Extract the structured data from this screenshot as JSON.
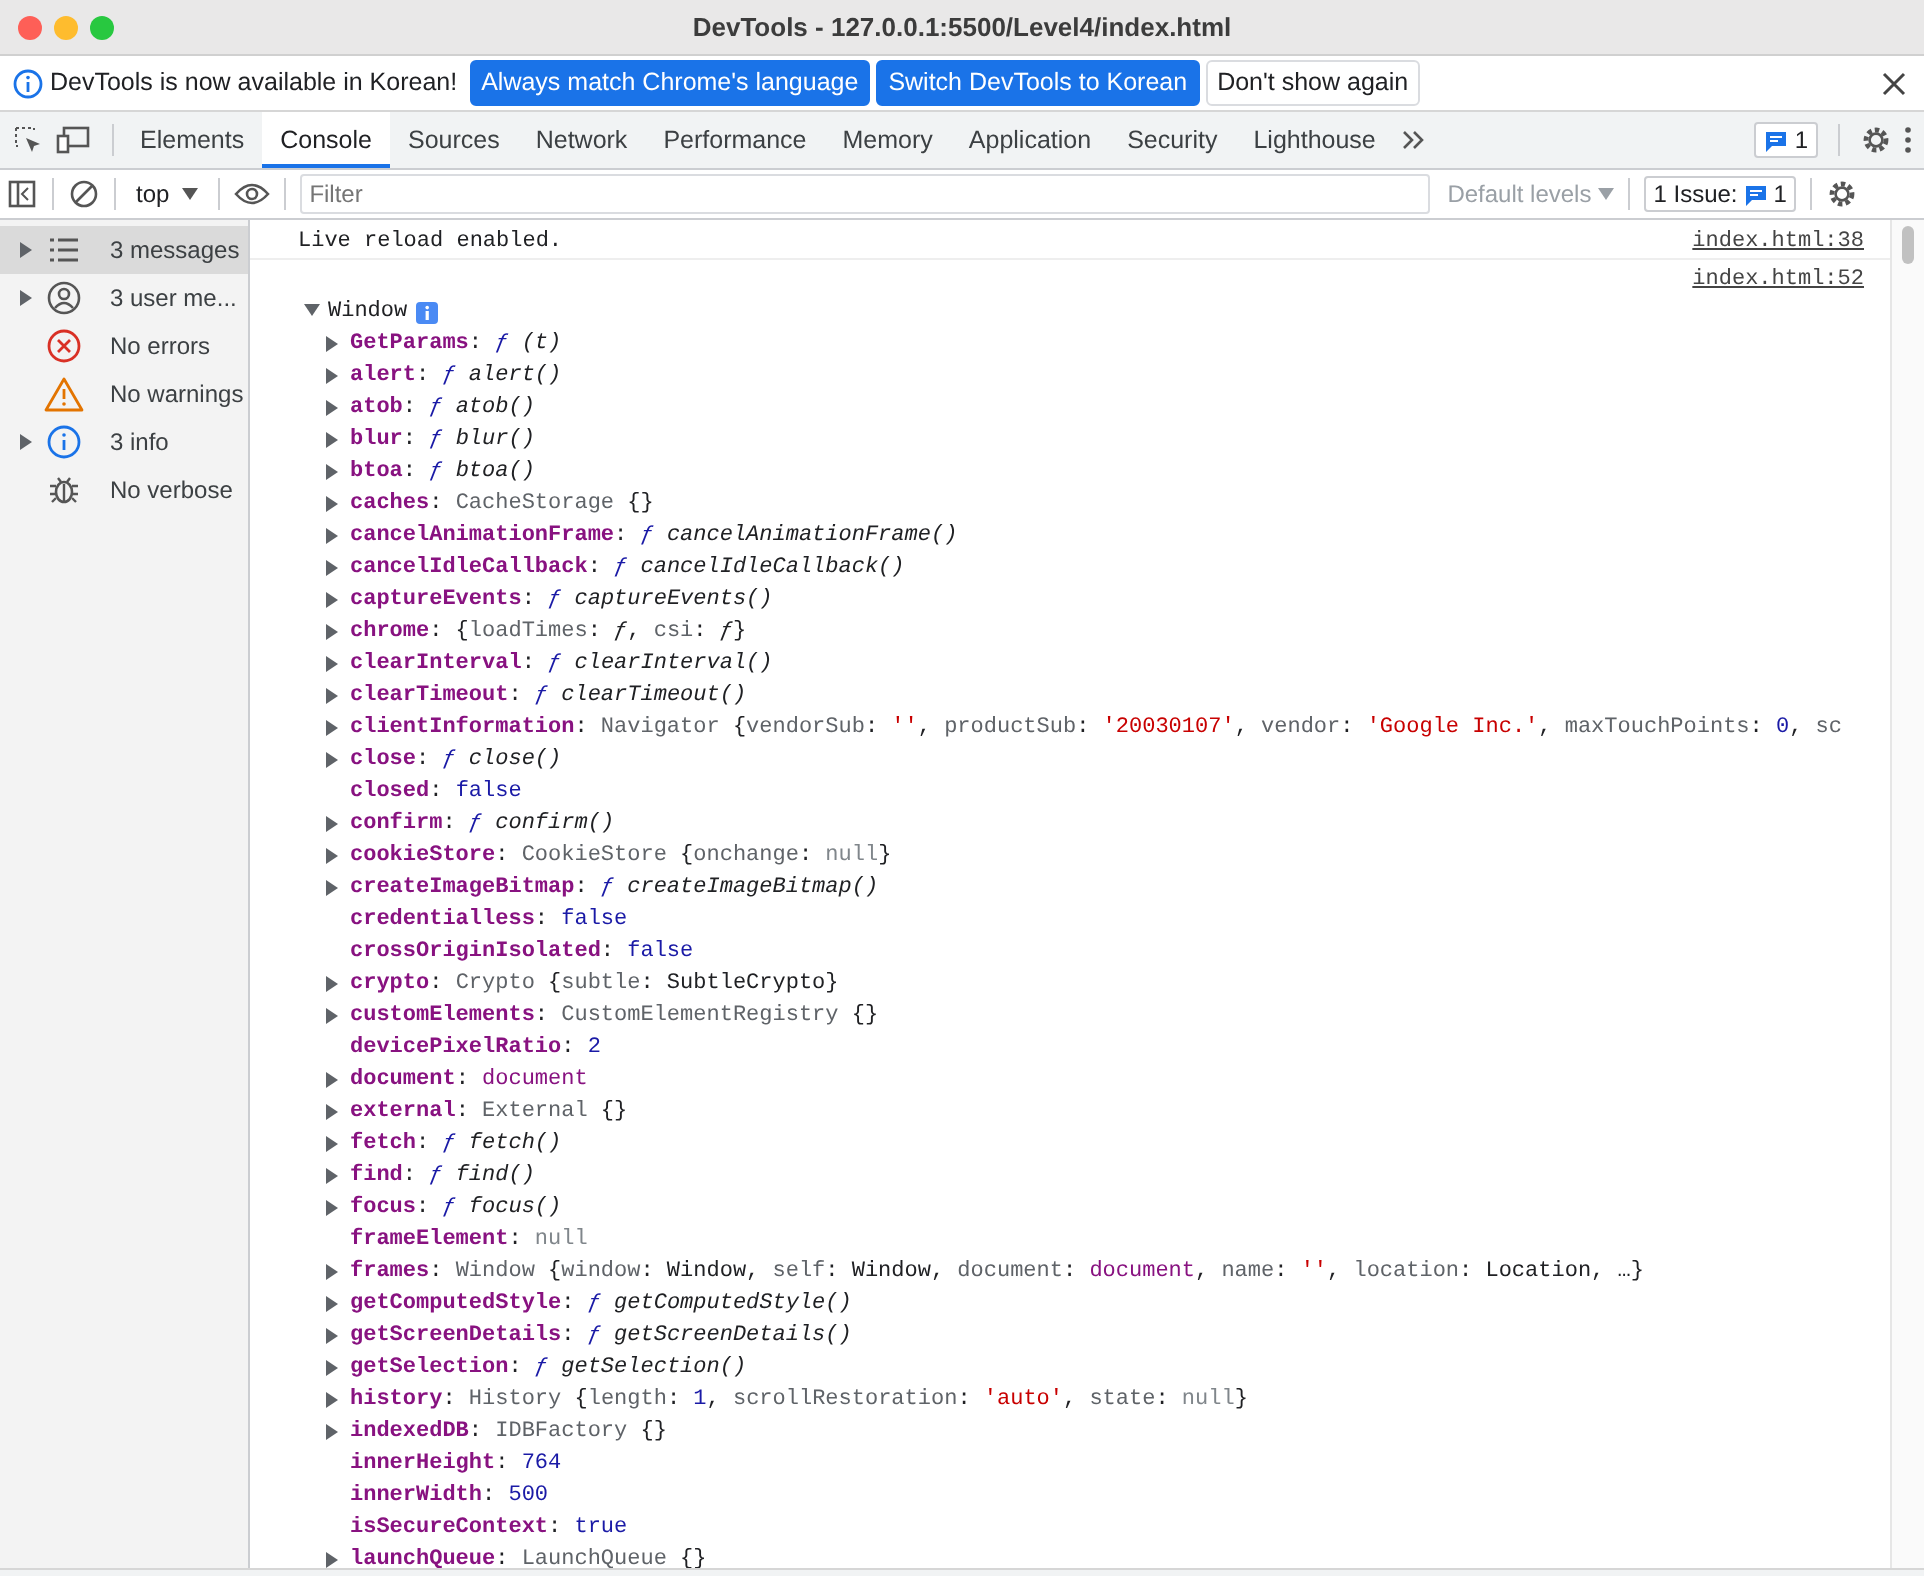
{
  "window": {
    "title": "DevTools - 127.0.0.1:5500/Level4/index.html"
  },
  "infobar": {
    "message": "DevTools is now available in Korean!",
    "buttons": [
      {
        "label": "Always match Chrome's language",
        "kind": "primary"
      },
      {
        "label": "Switch DevTools to Korean",
        "kind": "primary"
      },
      {
        "label": "Don't show again",
        "kind": "secondary"
      }
    ]
  },
  "tabs": [
    {
      "label": "Elements",
      "selected": false
    },
    {
      "label": "Console",
      "selected": true
    },
    {
      "label": "Sources",
      "selected": false
    },
    {
      "label": "Network",
      "selected": false
    },
    {
      "label": "Performance",
      "selected": false
    },
    {
      "label": "Memory",
      "selected": false
    },
    {
      "label": "Application",
      "selected": false
    },
    {
      "label": "Security",
      "selected": false
    },
    {
      "label": "Lighthouse",
      "selected": false
    }
  ],
  "message_badge": "1",
  "toolbar": {
    "context": "top",
    "filter_placeholder": "Filter",
    "levels": "Default levels",
    "issues_label": "1 Issue:",
    "issues_count": "1"
  },
  "sidebar": {
    "items": [
      {
        "kind": "messages",
        "label": "3 messages",
        "expandable": true,
        "selected": true
      },
      {
        "kind": "user",
        "label": "3 user me...",
        "expandable": true,
        "selected": false
      },
      {
        "kind": "errors",
        "label": "No errors",
        "expandable": false,
        "selected": false
      },
      {
        "kind": "warnings",
        "label": "No warnings",
        "expandable": false,
        "selected": false
      },
      {
        "kind": "info",
        "label": "3 info",
        "expandable": true,
        "selected": false
      },
      {
        "kind": "verbose",
        "label": "No verbose",
        "expandable": false,
        "selected": false
      }
    ]
  },
  "console": {
    "messages": [
      {
        "text": "Live reload enabled.",
        "source": "index.html:38"
      },
      {
        "source": "index.html:52",
        "object": {
          "label": "Window",
          "expanded": true,
          "properties": [
            {
              "key": "GetParams",
              "expandable": true,
              "value": [
                {
                  "kind": "punct",
                  "text": ": "
                },
                {
                  "kind": "fn",
                  "text": "ƒ"
                },
                {
                  "kind": "call",
                  "text": " (t)"
                }
              ]
            },
            {
              "key": "alert",
              "expandable": true,
              "value": [
                {
                  "kind": "punct",
                  "text": ": "
                },
                {
                  "kind": "fn",
                  "text": "ƒ"
                },
                {
                  "kind": "call",
                  "text": " alert()"
                }
              ]
            },
            {
              "key": "atob",
              "expandable": true,
              "value": [
                {
                  "kind": "punct",
                  "text": ": "
                },
                {
                  "kind": "fn",
                  "text": "ƒ"
                },
                {
                  "kind": "call",
                  "text": " atob()"
                }
              ]
            },
            {
              "key": "blur",
              "expandable": true,
              "value": [
                {
                  "kind": "punct",
                  "text": ": "
                },
                {
                  "kind": "fn",
                  "text": "ƒ"
                },
                {
                  "kind": "call",
                  "text": " blur()"
                }
              ]
            },
            {
              "key": "btoa",
              "expandable": true,
              "value": [
                {
                  "kind": "punct",
                  "text": ": "
                },
                {
                  "kind": "fn",
                  "text": "ƒ"
                },
                {
                  "kind": "call",
                  "text": " btoa()"
                }
              ]
            },
            {
              "key": "caches",
              "expandable": true,
              "value": [
                {
                  "kind": "punct",
                  "text": ": "
                },
                {
                  "kind": "type",
                  "text": "CacheStorage"
                },
                {
                  "kind": "punct",
                  "text": " {}"
                }
              ]
            },
            {
              "key": "cancelAnimationFrame",
              "expandable": true,
              "value": [
                {
                  "kind": "punct",
                  "text": ": "
                },
                {
                  "kind": "fn",
                  "text": "ƒ"
                },
                {
                  "kind": "call",
                  "text": " cancelAnimationFrame()"
                }
              ]
            },
            {
              "key": "cancelIdleCallback",
              "expandable": true,
              "value": [
                {
                  "kind": "punct",
                  "text": ": "
                },
                {
                  "kind": "fn",
                  "text": "ƒ"
                },
                {
                  "kind": "call",
                  "text": " cancelIdleCallback()"
                }
              ]
            },
            {
              "key": "captureEvents",
              "expandable": true,
              "value": [
                {
                  "kind": "punct",
                  "text": ": "
                },
                {
                  "kind": "fn",
                  "text": "ƒ"
                },
                {
                  "kind": "call",
                  "text": " captureEvents()"
                }
              ]
            },
            {
              "key": "chrome",
              "expandable": true,
              "value": [
                {
                  "kind": "punct",
                  "text": ": {"
                },
                {
                  "kind": "prop",
                  "text": "loadTimes"
                },
                {
                  "kind": "punct",
                  "text": ": "
                },
                {
                  "kind": "call",
                  "text": "ƒ"
                },
                {
                  "kind": "punct",
                  "text": ", "
                },
                {
                  "kind": "prop",
                  "text": "csi"
                },
                {
                  "kind": "punct",
                  "text": ": "
                },
                {
                  "kind": "call",
                  "text": "ƒ"
                },
                {
                  "kind": "punct",
                  "text": "}"
                }
              ]
            },
            {
              "key": "clearInterval",
              "expandable": true,
              "value": [
                {
                  "kind": "punct",
                  "text": ": "
                },
                {
                  "kind": "fn",
                  "text": "ƒ"
                },
                {
                  "kind": "call",
                  "text": " clearInterval()"
                }
              ]
            },
            {
              "key": "clearTimeout",
              "expandable": true,
              "value": [
                {
                  "kind": "punct",
                  "text": ": "
                },
                {
                  "kind": "fn",
                  "text": "ƒ"
                },
                {
                  "kind": "call",
                  "text": " clearTimeout()"
                }
              ]
            },
            {
              "key": "clientInformation",
              "expandable": true,
              "value": [
                {
                  "kind": "punct",
                  "text": ": "
                },
                {
                  "kind": "type",
                  "text": "Navigator"
                },
                {
                  "kind": "punct",
                  "text": " {"
                },
                {
                  "kind": "prop",
                  "text": "vendorSub"
                },
                {
                  "kind": "punct",
                  "text": ": "
                },
                {
                  "kind": "str",
                  "text": "''"
                },
                {
                  "kind": "punct",
                  "text": ", "
                },
                {
                  "kind": "prop",
                  "text": "productSub"
                },
                {
                  "kind": "punct",
                  "text": ": "
                },
                {
                  "kind": "str",
                  "text": "'20030107'"
                },
                {
                  "kind": "punct",
                  "text": ", "
                },
                {
                  "kind": "prop",
                  "text": "vendor"
                },
                {
                  "kind": "punct",
                  "text": ": "
                },
                {
                  "kind": "str",
                  "text": "'Google Inc.'"
                },
                {
                  "kind": "punct",
                  "text": ", "
                },
                {
                  "kind": "prop",
                  "text": "maxTouchPoints"
                },
                {
                  "kind": "punct",
                  "text": ": "
                },
                {
                  "kind": "num",
                  "text": "0"
                },
                {
                  "kind": "punct",
                  "text": ", "
                },
                {
                  "kind": "prop",
                  "text": "sc"
                }
              ]
            },
            {
              "key": "close",
              "expandable": true,
              "value": [
                {
                  "kind": "punct",
                  "text": ": "
                },
                {
                  "kind": "fn",
                  "text": "ƒ"
                },
                {
                  "kind": "call",
                  "text": " close()"
                }
              ]
            },
            {
              "key": "closed",
              "expandable": false,
              "value": [
                {
                  "kind": "punct",
                  "text": ": "
                },
                {
                  "kind": "num",
                  "text": "false"
                }
              ]
            },
            {
              "key": "confirm",
              "expandable": true,
              "value": [
                {
                  "kind": "punct",
                  "text": ": "
                },
                {
                  "kind": "fn",
                  "text": "ƒ"
                },
                {
                  "kind": "call",
                  "text": " confirm()"
                }
              ]
            },
            {
              "key": "cookieStore",
              "expandable": true,
              "value": [
                {
                  "kind": "punct",
                  "text": ": "
                },
                {
                  "kind": "type",
                  "text": "CookieStore"
                },
                {
                  "kind": "punct",
                  "text": " {"
                },
                {
                  "kind": "prop",
                  "text": "onchange"
                },
                {
                  "kind": "punct",
                  "text": ": "
                },
                {
                  "kind": "null",
                  "text": "null"
                },
                {
                  "kind": "punct",
                  "text": "}"
                }
              ]
            },
            {
              "key": "createImageBitmap",
              "expandable": true,
              "value": [
                {
                  "kind": "punct",
                  "text": ": "
                },
                {
                  "kind": "fn",
                  "text": "ƒ"
                },
                {
                  "kind": "call",
                  "text": " createImageBitmap()"
                }
              ]
            },
            {
              "key": "credentialless",
              "expandable": false,
              "value": [
                {
                  "kind": "punct",
                  "text": ": "
                },
                {
                  "kind": "num",
                  "text": "false"
                }
              ]
            },
            {
              "key": "crossOriginIsolated",
              "expandable": false,
              "value": [
                {
                  "kind": "punct",
                  "text": ": "
                },
                {
                  "kind": "num",
                  "text": "false"
                }
              ]
            },
            {
              "key": "crypto",
              "expandable": true,
              "value": [
                {
                  "kind": "punct",
                  "text": ": "
                },
                {
                  "kind": "type",
                  "text": "Crypto"
                },
                {
                  "kind": "punct",
                  "text": " {"
                },
                {
                  "kind": "prop",
                  "text": "subtle"
                },
                {
                  "kind": "punct",
                  "text": ": SubtleCrypto}"
                }
              ]
            },
            {
              "key": "customElements",
              "expandable": true,
              "value": [
                {
                  "kind": "punct",
                  "text": ": "
                },
                {
                  "kind": "type",
                  "text": "CustomElementRegistry"
                },
                {
                  "kind": "punct",
                  "text": " {}"
                }
              ]
            },
            {
              "key": "devicePixelRatio",
              "expandable": false,
              "value": [
                {
                  "kind": "punct",
                  "text": ": "
                },
                {
                  "kind": "num",
                  "text": "2"
                }
              ]
            },
            {
              "key": "document",
              "expandable": true,
              "value": [
                {
                  "kind": "punct",
                  "text": ": "
                },
                {
                  "kind": "ref",
                  "text": "document"
                }
              ]
            },
            {
              "key": "external",
              "expandable": true,
              "value": [
                {
                  "kind": "punct",
                  "text": ": "
                },
                {
                  "kind": "type",
                  "text": "External"
                },
                {
                  "kind": "punct",
                  "text": " {}"
                }
              ]
            },
            {
              "key": "fetch",
              "expandable": true,
              "value": [
                {
                  "kind": "punct",
                  "text": ": "
                },
                {
                  "kind": "fn",
                  "text": "ƒ"
                },
                {
                  "kind": "call",
                  "text": " fetch()"
                }
              ]
            },
            {
              "key": "find",
              "expandable": true,
              "value": [
                {
                  "kind": "punct",
                  "text": ": "
                },
                {
                  "kind": "fn",
                  "text": "ƒ"
                },
                {
                  "kind": "call",
                  "text": " find()"
                }
              ]
            },
            {
              "key": "focus",
              "expandable": true,
              "value": [
                {
                  "kind": "punct",
                  "text": ": "
                },
                {
                  "kind": "fn",
                  "text": "ƒ"
                },
                {
                  "kind": "call",
                  "text": " focus()"
                }
              ]
            },
            {
              "key": "frameElement",
              "expandable": false,
              "value": [
                {
                  "kind": "punct",
                  "text": ": "
                },
                {
                  "kind": "null",
                  "text": "null"
                }
              ]
            },
            {
              "key": "frames",
              "expandable": true,
              "value": [
                {
                  "kind": "punct",
                  "text": ": "
                },
                {
                  "kind": "type",
                  "text": "Window"
                },
                {
                  "kind": "punct",
                  "text": " {"
                },
                {
                  "kind": "prop",
                  "text": "window"
                },
                {
                  "kind": "punct",
                  "text": ": Window, "
                },
                {
                  "kind": "prop",
                  "text": "self"
                },
                {
                  "kind": "punct",
                  "text": ": Window, "
                },
                {
                  "kind": "prop",
                  "text": "document"
                },
                {
                  "kind": "punct",
                  "text": ": "
                },
                {
                  "kind": "ref",
                  "text": "document"
                },
                {
                  "kind": "punct",
                  "text": ", "
                },
                {
                  "kind": "prop",
                  "text": "name"
                },
                {
                  "kind": "punct",
                  "text": ": "
                },
                {
                  "kind": "str",
                  "text": "''"
                },
                {
                  "kind": "punct",
                  "text": ", "
                },
                {
                  "kind": "prop",
                  "text": "location"
                },
                {
                  "kind": "punct",
                  "text": ": Location, …}"
                }
              ]
            },
            {
              "key": "getComputedStyle",
              "expandable": true,
              "value": [
                {
                  "kind": "punct",
                  "text": ": "
                },
                {
                  "kind": "fn",
                  "text": "ƒ"
                },
                {
                  "kind": "call",
                  "text": " getComputedStyle()"
                }
              ]
            },
            {
              "key": "getScreenDetails",
              "expandable": true,
              "value": [
                {
                  "kind": "punct",
                  "text": ": "
                },
                {
                  "kind": "fn",
                  "text": "ƒ"
                },
                {
                  "kind": "call",
                  "text": " getScreenDetails()"
                }
              ]
            },
            {
              "key": "getSelection",
              "expandable": true,
              "value": [
                {
                  "kind": "punct",
                  "text": ": "
                },
                {
                  "kind": "fn",
                  "text": "ƒ"
                },
                {
                  "kind": "call",
                  "text": " getSelection()"
                }
              ]
            },
            {
              "key": "history",
              "expandable": true,
              "value": [
                {
                  "kind": "punct",
                  "text": ": "
                },
                {
                  "kind": "type",
                  "text": "History"
                },
                {
                  "kind": "punct",
                  "text": " {"
                },
                {
                  "kind": "prop",
                  "text": "length"
                },
                {
                  "kind": "punct",
                  "text": ": "
                },
                {
                  "kind": "num",
                  "text": "1"
                },
                {
                  "kind": "punct",
                  "text": ", "
                },
                {
                  "kind": "prop",
                  "text": "scrollRestoration"
                },
                {
                  "kind": "punct",
                  "text": ": "
                },
                {
                  "kind": "str",
                  "text": "'auto'"
                },
                {
                  "kind": "punct",
                  "text": ", "
                },
                {
                  "kind": "prop",
                  "text": "state"
                },
                {
                  "kind": "punct",
                  "text": ": "
                },
                {
                  "kind": "null",
                  "text": "null"
                },
                {
                  "kind": "punct",
                  "text": "}"
                }
              ]
            },
            {
              "key": "indexedDB",
              "expandable": true,
              "value": [
                {
                  "kind": "punct",
                  "text": ": "
                },
                {
                  "kind": "type",
                  "text": "IDBFactory"
                },
                {
                  "kind": "punct",
                  "text": " {}"
                }
              ]
            },
            {
              "key": "innerHeight",
              "expandable": false,
              "value": [
                {
                  "kind": "punct",
                  "text": ": "
                },
                {
                  "kind": "num",
                  "text": "764"
                }
              ]
            },
            {
              "key": "innerWidth",
              "expandable": false,
              "value": [
                {
                  "kind": "punct",
                  "text": ": "
                },
                {
                  "kind": "num",
                  "text": "500"
                }
              ]
            },
            {
              "key": "isSecureContext",
              "expandable": false,
              "value": [
                {
                  "kind": "punct",
                  "text": ": "
                },
                {
                  "kind": "num",
                  "text": "true"
                }
              ]
            },
            {
              "key": "launchQueue",
              "expandable": true,
              "value": [
                {
                  "kind": "punct",
                  "text": ": "
                },
                {
                  "kind": "type",
                  "text": "LaunchQueue"
                },
                {
                  "kind": "punct",
                  "text": " {}"
                }
              ]
            }
          ]
        }
      }
    ]
  }
}
